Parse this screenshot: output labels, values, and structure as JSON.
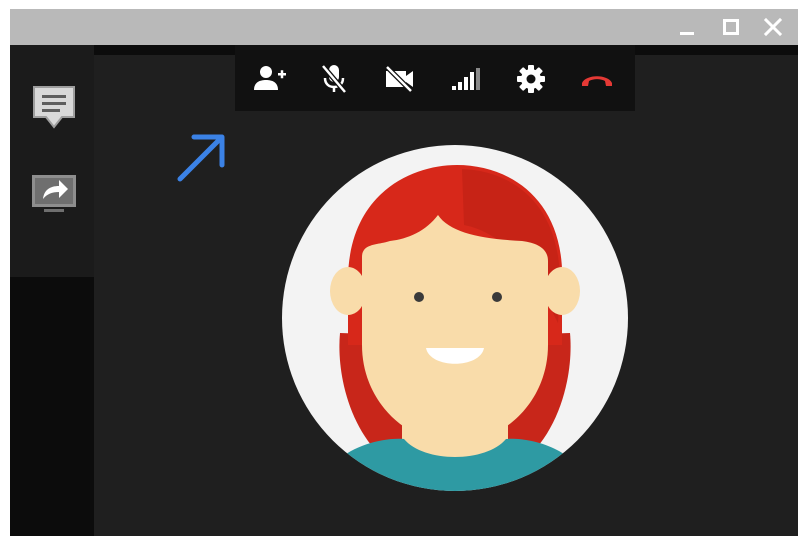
{
  "window": {
    "controls": [
      {
        "name": "minimize",
        "icon": "minimize-icon"
      },
      {
        "name": "maximize",
        "icon": "maximize-icon"
      },
      {
        "name": "close",
        "icon": "close-icon"
      }
    ]
  },
  "sidebar": {
    "items": [
      {
        "name": "chat",
        "icon": "chat-icon"
      },
      {
        "name": "screen-share",
        "icon": "screen-share-icon"
      }
    ]
  },
  "toolbar": {
    "items": [
      {
        "name": "add-person",
        "icon": "add-person-icon"
      },
      {
        "name": "mute-microphone",
        "icon": "mic-off-icon"
      },
      {
        "name": "camera-off",
        "icon": "video-off-icon"
      },
      {
        "name": "connection-quality",
        "icon": "signal-bars-icon"
      },
      {
        "name": "settings",
        "icon": "gear-icon"
      },
      {
        "name": "hang-up",
        "icon": "hang-up-icon"
      }
    ]
  },
  "annotation": {
    "icon": "arrow-up-right-icon",
    "color": "#3b82e6"
  },
  "participant": {
    "icon": "person-avatar-icon"
  },
  "colors": {
    "titlebar": "#b9b9b9",
    "window_bg": "#0c0c0c",
    "sidebar_bg": "#1b1b1b",
    "stage_bg": "#1f1f1f",
    "toolbar_bg": "#111111",
    "hang_up": "#e53935",
    "avatar_bg": "#f3f3f3",
    "hair": "#d7281a",
    "skin": "#f9dcaa",
    "shirt": "#2e9aa3",
    "annotation_arrow": "#3b82e6"
  }
}
